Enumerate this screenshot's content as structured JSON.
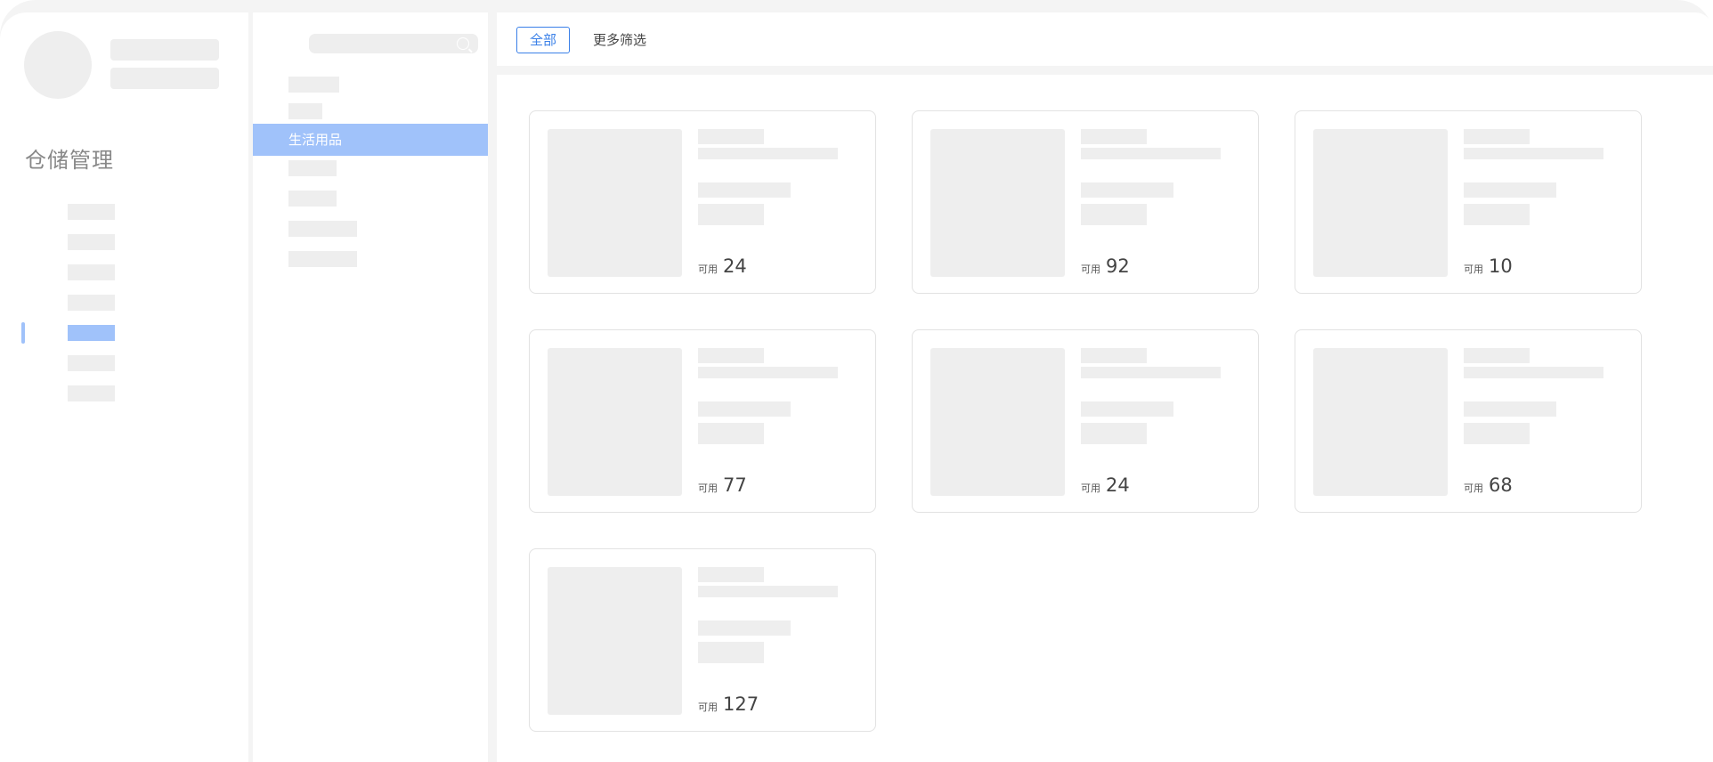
{
  "sidebar": {
    "app_title": "仓储管理",
    "nav_count": 7,
    "active_nav_index": 4
  },
  "categories": {
    "selected_label": "生活用品"
  },
  "toolbar": {
    "tab_all_label": "全部",
    "more_filter_label": "更多筛选"
  },
  "cards": [
    {
      "available_label": "可用",
      "available_value": "24"
    },
    {
      "available_label": "可用",
      "available_value": "92"
    },
    {
      "available_label": "可用",
      "available_value": "10"
    },
    {
      "available_label": "可用",
      "available_value": "77"
    },
    {
      "available_label": "可用",
      "available_value": "24"
    },
    {
      "available_label": "可用",
      "available_value": "68"
    },
    {
      "available_label": "可用",
      "available_value": "127"
    }
  ],
  "colors": {
    "accent": "#3a80e8",
    "selection": "#a0c2fa",
    "placeholder": "#eeeeee",
    "background": "#f4f4f4"
  }
}
